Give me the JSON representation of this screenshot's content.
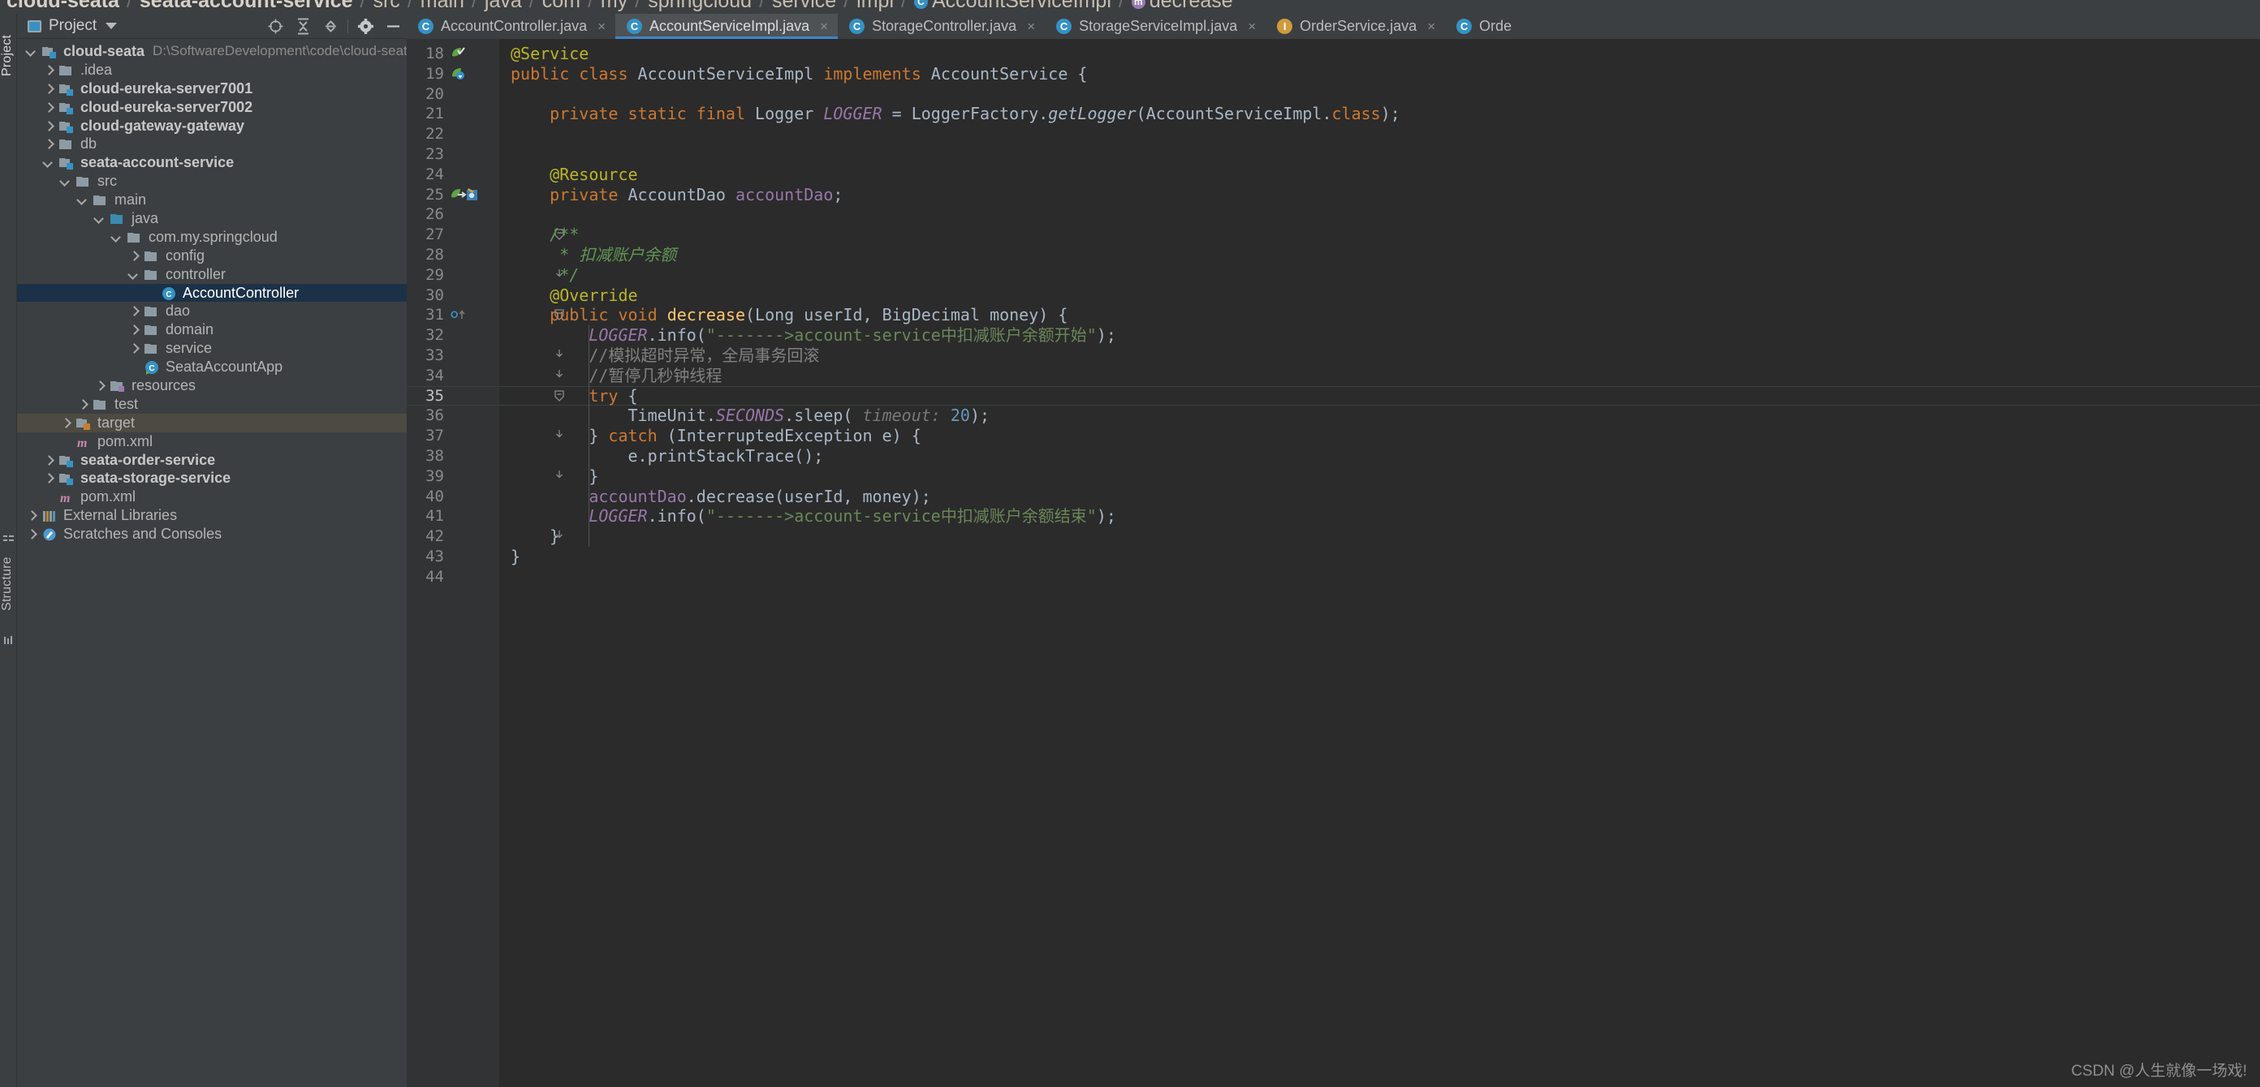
{
  "breadcrumb": {
    "items": [
      {
        "label": "cloud-seata",
        "bold": true,
        "icon": ""
      },
      {
        "label": "seata-account-service",
        "bold": true,
        "icon": ""
      },
      {
        "label": "src",
        "bold": false,
        "icon": ""
      },
      {
        "label": "main",
        "bold": false,
        "icon": ""
      },
      {
        "label": "java",
        "bold": false,
        "icon": ""
      },
      {
        "label": "com",
        "bold": false,
        "icon": ""
      },
      {
        "label": "my",
        "bold": false,
        "icon": ""
      },
      {
        "label": "springcloud",
        "bold": false,
        "icon": ""
      },
      {
        "label": "service",
        "bold": false,
        "icon": ""
      },
      {
        "label": "impl",
        "bold": false,
        "icon": ""
      },
      {
        "label": "AccountServiceImpl",
        "bold": false,
        "icon": "class-icon"
      },
      {
        "label": "decrease",
        "bold": false,
        "icon": "method-icon"
      }
    ],
    "separator": "/"
  },
  "left_strip": {
    "project_tab": "Project",
    "structure_tab": "Structure"
  },
  "project_panel": {
    "title": "Project",
    "chevron_icon": "chevron-down-icon",
    "project_icon": "project-icon",
    "toolbar": [
      {
        "name": "locate-icon",
        "tooltip": "Select Opened File"
      },
      {
        "name": "expand-all-icon",
        "tooltip": "Expand All"
      },
      {
        "name": "collapse-all-icon",
        "tooltip": "Collapse All"
      },
      {
        "name": "gear-icon",
        "tooltip": "Settings"
      },
      {
        "name": "hide-icon",
        "tooltip": "Hide"
      }
    ]
  },
  "tree": [
    {
      "label": "cloud-seata",
      "path": "D:\\SoftwareDevelopment\\code\\cloud-seata",
      "depth": 0,
      "arrow": "down",
      "icon": "module-folder",
      "bold": true,
      "state": "normal"
    },
    {
      "label": ".idea",
      "path": "",
      "depth": 1,
      "arrow": "right",
      "icon": "folder",
      "bold": false,
      "state": "normal"
    },
    {
      "label": "cloud-eureka-server7001",
      "path": "",
      "depth": 1,
      "arrow": "right",
      "icon": "module-folder",
      "bold": true,
      "state": "normal"
    },
    {
      "label": "cloud-eureka-server7002",
      "path": "",
      "depth": 1,
      "arrow": "right",
      "icon": "module-folder",
      "bold": true,
      "state": "normal"
    },
    {
      "label": "cloud-gateway-gateway",
      "path": "",
      "depth": 1,
      "arrow": "right",
      "icon": "module-folder",
      "bold": true,
      "state": "normal"
    },
    {
      "label": "db",
      "path": "",
      "depth": 1,
      "arrow": "right",
      "icon": "folder",
      "bold": false,
      "state": "normal"
    },
    {
      "label": "seata-account-service",
      "path": "",
      "depth": 1,
      "arrow": "down",
      "icon": "module-folder",
      "bold": true,
      "state": "normal"
    },
    {
      "label": "src",
      "path": "",
      "depth": 2,
      "arrow": "down",
      "icon": "folder",
      "bold": false,
      "state": "normal"
    },
    {
      "label": "main",
      "path": "",
      "depth": 3,
      "arrow": "down",
      "icon": "folder",
      "bold": false,
      "state": "normal"
    },
    {
      "label": "java",
      "path": "",
      "depth": 4,
      "arrow": "down",
      "icon": "source-folder",
      "bold": false,
      "state": "normal"
    },
    {
      "label": "com.my.springcloud",
      "path": "",
      "depth": 5,
      "arrow": "down",
      "icon": "package",
      "bold": false,
      "state": "normal"
    },
    {
      "label": "config",
      "path": "",
      "depth": 6,
      "arrow": "right",
      "icon": "package",
      "bold": false,
      "state": "normal"
    },
    {
      "label": "controller",
      "path": "",
      "depth": 6,
      "arrow": "down",
      "icon": "package",
      "bold": false,
      "state": "normal"
    },
    {
      "label": "AccountController",
      "path": "",
      "depth": 7,
      "arrow": "none",
      "icon": "java-class",
      "bold": false,
      "state": "selected"
    },
    {
      "label": "dao",
      "path": "",
      "depth": 6,
      "arrow": "right",
      "icon": "package",
      "bold": false,
      "state": "normal"
    },
    {
      "label": "domain",
      "path": "",
      "depth": 6,
      "arrow": "right",
      "icon": "package",
      "bold": false,
      "state": "normal"
    },
    {
      "label": "service",
      "path": "",
      "depth": 6,
      "arrow": "right",
      "icon": "package",
      "bold": false,
      "state": "normal"
    },
    {
      "label": "SeataAccountApp",
      "path": "",
      "depth": 6,
      "arrow": "none",
      "icon": "java-class-run",
      "bold": false,
      "state": "normal"
    },
    {
      "label": "resources",
      "path": "",
      "depth": 4,
      "arrow": "right",
      "icon": "resource-folder",
      "bold": false,
      "state": "normal"
    },
    {
      "label": "test",
      "path": "",
      "depth": 3,
      "arrow": "right",
      "icon": "folder",
      "bold": false,
      "state": "normal"
    },
    {
      "label": "target",
      "path": "",
      "depth": 2,
      "arrow": "right",
      "icon": "excluded-folder",
      "bold": false,
      "state": "highlight"
    },
    {
      "label": "pom.xml",
      "path": "",
      "depth": 2,
      "arrow": "none",
      "icon": "maven-file",
      "bold": false,
      "state": "normal"
    },
    {
      "label": "seata-order-service",
      "path": "",
      "depth": 1,
      "arrow": "right",
      "icon": "module-folder",
      "bold": true,
      "state": "normal"
    },
    {
      "label": "seata-storage-service",
      "path": "",
      "depth": 1,
      "arrow": "right",
      "icon": "module-folder",
      "bold": true,
      "state": "normal"
    },
    {
      "label": "pom.xml",
      "path": "",
      "depth": 1,
      "arrow": "none",
      "icon": "maven-file",
      "bold": false,
      "state": "normal"
    },
    {
      "label": "External Libraries",
      "path": "",
      "depth": 0,
      "arrow": "right",
      "icon": "library",
      "bold": false,
      "state": "normal"
    },
    {
      "label": "Scratches and Consoles",
      "path": "",
      "depth": 0,
      "arrow": "right",
      "icon": "scratch",
      "bold": false,
      "state": "normal"
    }
  ],
  "editor_tabs": [
    {
      "label": "AccountController.java",
      "icon": "class-icon",
      "active": false,
      "closable": true
    },
    {
      "label": "AccountServiceImpl.java",
      "icon": "class-icon",
      "active": true,
      "closable": true
    },
    {
      "label": "StorageController.java",
      "icon": "class-icon",
      "active": false,
      "closable": true
    },
    {
      "label": "StorageServiceImpl.java",
      "icon": "class-icon",
      "active": false,
      "closable": true
    },
    {
      "label": "OrderService.java",
      "icon": "interface-icon",
      "active": false,
      "closable": true
    },
    {
      "label": "Orde",
      "icon": "class-icon",
      "active": false,
      "closable": false
    }
  ],
  "code": {
    "first_line": 18,
    "lines": [
      {
        "n": 18,
        "gutter_icon": "green-bean-check",
        "fold": "",
        "tokens": [
          {
            "t": "@Service",
            "c": "ann"
          }
        ]
      },
      {
        "n": 19,
        "gutter_icon": "green-bean-override",
        "fold": "",
        "tokens": [
          {
            "t": "public ",
            "c": "kw"
          },
          {
            "t": "class ",
            "c": "kw"
          },
          {
            "t": "AccountServiceImpl ",
            "c": "cls2"
          },
          {
            "t": "implements ",
            "c": "kw"
          },
          {
            "t": "AccountService {",
            "c": "typ"
          }
        ]
      },
      {
        "n": 20,
        "gutter_icon": "",
        "fold": "",
        "tokens": []
      },
      {
        "n": 21,
        "gutter_icon": "",
        "fold": "",
        "tokens": [
          {
            "t": "    ",
            "c": "typ"
          },
          {
            "t": "private static final ",
            "c": "kw"
          },
          {
            "t": "Logger ",
            "c": "typ"
          },
          {
            "t": "LOGGER ",
            "c": "sfld"
          },
          {
            "t": "= LoggerFactory.",
            "c": "typ"
          },
          {
            "t": "getLogger",
            "c": "stat"
          },
          {
            "t": "(AccountServiceImpl.",
            "c": "typ"
          },
          {
            "t": "class",
            "c": "kw"
          },
          {
            "t": ");",
            "c": "typ"
          }
        ]
      },
      {
        "n": 22,
        "gutter_icon": "",
        "fold": "",
        "tokens": []
      },
      {
        "n": 23,
        "gutter_icon": "",
        "fold": "",
        "tokens": []
      },
      {
        "n": 24,
        "gutter_icon": "",
        "fold": "",
        "tokens": [
          {
            "t": "    ",
            "c": "typ"
          },
          {
            "t": "@Resource",
            "c": "ann"
          }
        ]
      },
      {
        "n": 25,
        "gutter_icon": "green-bean-arrow spring-bean",
        "fold": "",
        "tokens": [
          {
            "t": "    ",
            "c": "typ"
          },
          {
            "t": "private ",
            "c": "kw"
          },
          {
            "t": "AccountDao ",
            "c": "typ"
          },
          {
            "t": "accountDao",
            "c": "fld"
          },
          {
            "t": ";",
            "c": "typ"
          }
        ]
      },
      {
        "n": 26,
        "gutter_icon": "",
        "fold": "",
        "tokens": []
      },
      {
        "n": 27,
        "gutter_icon": "",
        "fold": "minus",
        "tokens": [
          {
            "t": "    ",
            "c": "typ"
          },
          {
            "t": "/**",
            "c": "doc"
          }
        ]
      },
      {
        "n": 28,
        "gutter_icon": "",
        "fold": "",
        "tokens": [
          {
            "t": "     ",
            "c": "typ"
          },
          {
            "t": "* 扣减账户余额",
            "c": "doc"
          }
        ]
      },
      {
        "n": 29,
        "gutter_icon": "",
        "fold": "end",
        "tokens": [
          {
            "t": "     ",
            "c": "typ"
          },
          {
            "t": "*/",
            "c": "doc"
          }
        ]
      },
      {
        "n": 30,
        "gutter_icon": "",
        "fold": "",
        "tokens": [
          {
            "t": "    ",
            "c": "typ"
          },
          {
            "t": "@Override",
            "c": "ann"
          }
        ]
      },
      {
        "n": 31,
        "gutter_icon": "override-arrow",
        "fold": "minus",
        "tokens": [
          {
            "t": "    ",
            "c": "typ"
          },
          {
            "t": "public ",
            "c": "kw"
          },
          {
            "t": "void ",
            "c": "kw"
          },
          {
            "t": "decrease",
            "c": "mth"
          },
          {
            "t": "(Long ",
            "c": "typ"
          },
          {
            "t": "userId",
            "c": "typ"
          },
          {
            "t": ", BigDecimal ",
            "c": "typ"
          },
          {
            "t": "money",
            "c": "typ"
          },
          {
            "t": ") {",
            "c": "typ"
          }
        ]
      },
      {
        "n": 32,
        "gutter_icon": "",
        "fold": "",
        "tokens": [
          {
            "t": "        ",
            "c": "typ"
          },
          {
            "t": "LOGGER",
            "c": "sfld"
          },
          {
            "t": ".info(",
            "c": "typ"
          },
          {
            "t": "\"------->account-service中扣减账户余额开始\"",
            "c": "str"
          },
          {
            "t": ");",
            "c": "typ"
          }
        ]
      },
      {
        "n": 33,
        "gutter_icon": "",
        "fold": "end",
        "tokens": [
          {
            "t": "        ",
            "c": "typ"
          },
          {
            "t": "//模拟超时异常，全局事务回滚",
            "c": "cmt"
          }
        ]
      },
      {
        "n": 34,
        "gutter_icon": "",
        "fold": "end",
        "tokens": [
          {
            "t": "        ",
            "c": "typ"
          },
          {
            "t": "//暂停几秒钟线程",
            "c": "cmt"
          }
        ]
      },
      {
        "n": 35,
        "gutter_icon": "",
        "fold": "minus",
        "tokens": [
          {
            "t": "        ",
            "c": "typ"
          },
          {
            "t": "try ",
            "c": "kw"
          },
          {
            "t": "{",
            "c": "typ"
          }
        ]
      },
      {
        "n": 36,
        "gutter_icon": "",
        "fold": "",
        "tokens": [
          {
            "t": "            TimeUnit.",
            "c": "typ"
          },
          {
            "t": "SECONDS",
            "c": "sfld"
          },
          {
            "t": ".sleep( ",
            "c": "typ"
          },
          {
            "t": "timeout: ",
            "c": "hint"
          },
          {
            "t": "20",
            "c": "num"
          },
          {
            "t": ");",
            "c": "typ"
          }
        ]
      },
      {
        "n": 37,
        "gutter_icon": "",
        "fold": "end",
        "tokens": [
          {
            "t": "        ",
            "c": "typ"
          },
          {
            "t": "} ",
            "c": "typ"
          },
          {
            "t": "catch ",
            "c": "kw"
          },
          {
            "t": "(InterruptedException e) {",
            "c": "typ"
          }
        ]
      },
      {
        "n": 38,
        "gutter_icon": "",
        "fold": "",
        "tokens": [
          {
            "t": "            e.printStackTrace();",
            "c": "typ"
          }
        ]
      },
      {
        "n": 39,
        "gutter_icon": "",
        "fold": "end",
        "tokens": [
          {
            "t": "        }",
            "c": "typ"
          }
        ]
      },
      {
        "n": 40,
        "gutter_icon": "",
        "fold": "",
        "tokens": [
          {
            "t": "        ",
            "c": "typ"
          },
          {
            "t": "accountDao",
            "c": "fld"
          },
          {
            "t": ".decrease(",
            "c": "typ"
          },
          {
            "t": "userId",
            "c": "typ"
          },
          {
            "t": ", ",
            "c": "typ"
          },
          {
            "t": "money",
            "c": "typ"
          },
          {
            "t": ");",
            "c": "typ"
          }
        ]
      },
      {
        "n": 41,
        "gutter_icon": "",
        "fold": "",
        "tokens": [
          {
            "t": "        ",
            "c": "typ"
          },
          {
            "t": "LOGGER",
            "c": "sfld"
          },
          {
            "t": ".info(",
            "c": "typ"
          },
          {
            "t": "\"------->account-service中扣减账户余额结束\"",
            "c": "str"
          },
          {
            "t": ");",
            "c": "typ"
          }
        ]
      },
      {
        "n": 42,
        "gutter_icon": "",
        "fold": "end",
        "tokens": [
          {
            "t": "    }",
            "c": "typ"
          }
        ]
      },
      {
        "n": 43,
        "gutter_icon": "",
        "fold": "",
        "tokens": [
          {
            "t": "}",
            "c": "typ"
          }
        ]
      },
      {
        "n": 44,
        "gutter_icon": "",
        "fold": "",
        "tokens": []
      }
    ],
    "current_line": 35
  },
  "watermark": "CSDN @人生就像一场戏!",
  "colors": {
    "accent": "#3592c4",
    "tab_active_underline": "#3d86c9",
    "selection": "#1b3147",
    "editor_bg": "#2b2b2b",
    "panel_bg": "#3c3f41",
    "gutter_bg": "#313335",
    "string": "#6a8759",
    "keyword": "#cc7832",
    "annotation": "#bbb529",
    "comment": "#808080",
    "javadoc": "#629755",
    "field": "#9876aa",
    "method": "#ffc66d",
    "number": "#6897bb"
  }
}
